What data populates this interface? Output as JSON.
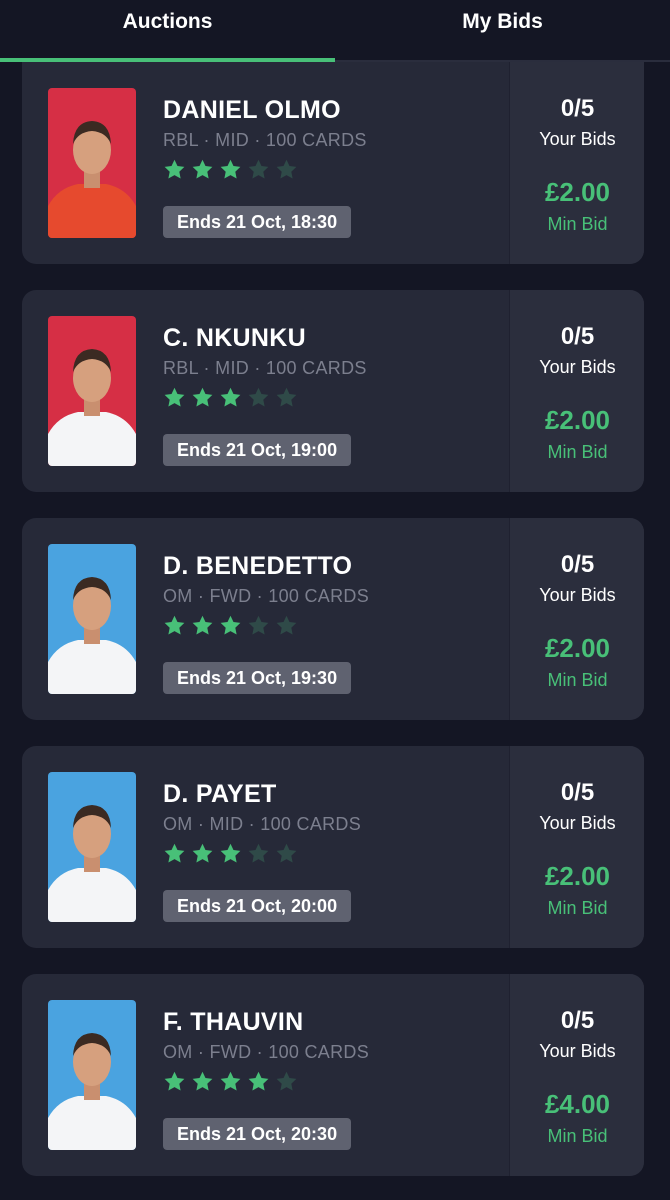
{
  "tabs": [
    {
      "label": "Auctions",
      "active": true
    },
    {
      "label": "My Bids",
      "active": false
    }
  ],
  "colors": {
    "accent": "#48c078",
    "star_off": "#2f4a48",
    "red_bg": "#d62f45",
    "blue_bg": "#4aa3e0"
  },
  "cards": [
    {
      "name": "DANIEL OLMO",
      "meta": "RBL · MID · 100 CARDS",
      "stars": 3,
      "ends": "Ends 21 Oct, 18:30",
      "bids": "0/5",
      "bids_label": "Your Bids",
      "min_bid": "£2.00",
      "min_label": "Min Bid",
      "photo_bg": "red"
    },
    {
      "name": "C. NKUNKU",
      "meta": "RBL · MID · 100 CARDS",
      "stars": 3,
      "ends": "Ends 21 Oct, 19:00",
      "bids": "0/5",
      "bids_label": "Your Bids",
      "min_bid": "£2.00",
      "min_label": "Min Bid",
      "photo_bg": "red"
    },
    {
      "name": "D. BENEDETTO",
      "meta": "OM · FWD · 100 CARDS",
      "stars": 3,
      "ends": "Ends 21 Oct, 19:30",
      "bids": "0/5",
      "bids_label": "Your Bids",
      "min_bid": "£2.00",
      "min_label": "Min Bid",
      "photo_bg": "blue"
    },
    {
      "name": "D. PAYET",
      "meta": "OM · MID · 100 CARDS",
      "stars": 3,
      "ends": "Ends 21 Oct, 20:00",
      "bids": "0/5",
      "bids_label": "Your Bids",
      "min_bid": "£2.00",
      "min_label": "Min Bid",
      "photo_bg": "blue"
    },
    {
      "name": "F. THAUVIN",
      "meta": "OM · FWD · 100 CARDS",
      "stars": 4,
      "ends": "Ends 21 Oct, 20:30",
      "bids": "0/5",
      "bids_label": "Your Bids",
      "min_bid": "£4.00",
      "min_label": "Min Bid",
      "photo_bg": "blue"
    }
  ]
}
